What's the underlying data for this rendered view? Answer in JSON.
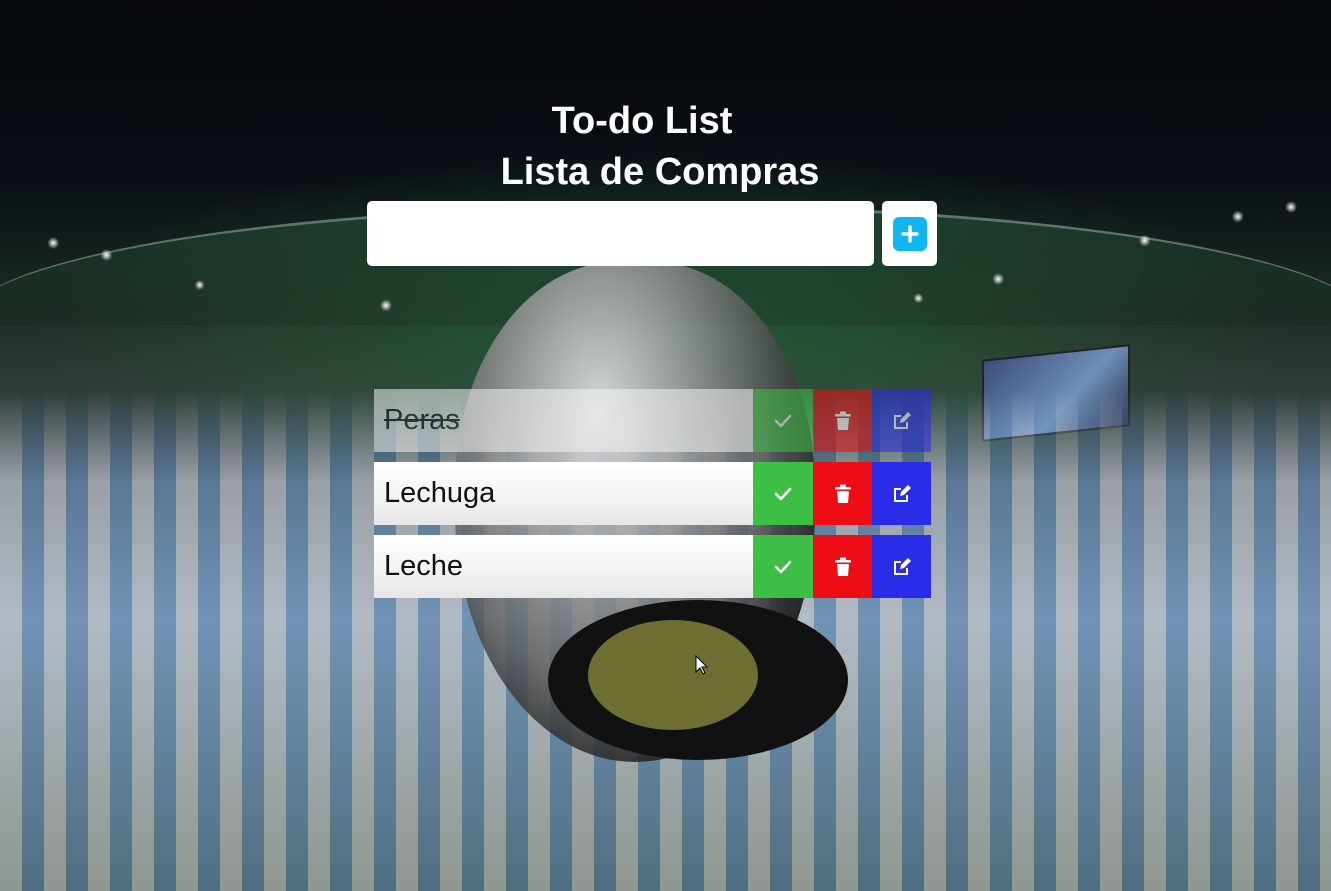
{
  "header": {
    "title": "To-do List",
    "subtitle": "Lista de Compras"
  },
  "add_form": {
    "input_value": "",
    "add_button_icon": "plus-icon"
  },
  "items": [
    {
      "label": "Peras",
      "completed": true
    },
    {
      "label": "Lechuga",
      "completed": false
    },
    {
      "label": "Leche",
      "completed": false
    }
  ],
  "item_actions": {
    "complete_icon": "check-icon",
    "delete_icon": "trash-icon",
    "edit_icon": "edit-icon"
  },
  "colors": {
    "complete": "#3dbf45",
    "delete": "#ee0d14",
    "edit": "#2b2ce8",
    "add_accent": "#10b6f0"
  }
}
